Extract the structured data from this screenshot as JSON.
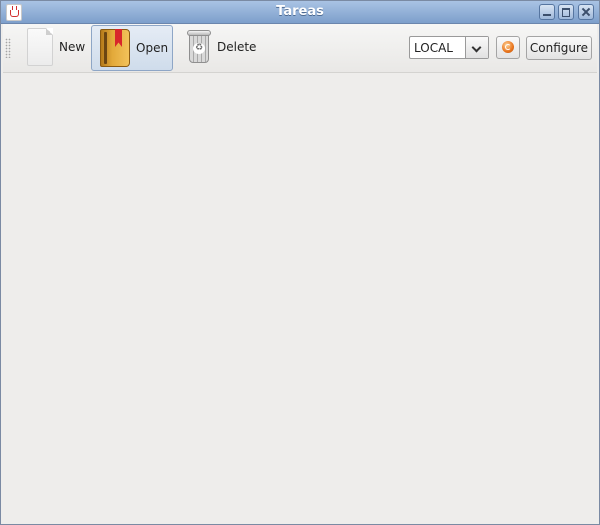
{
  "window": {
    "title": "Tareas",
    "controls": [
      "minimize-icon",
      "maximize-icon",
      "close-icon"
    ]
  },
  "toolbar": {
    "new_label": "New",
    "open_label": "Open",
    "delete_label": "Delete",
    "location_select": {
      "selected": "LOCAL"
    },
    "configure_label": "Configure",
    "icons": {
      "new": "document-icon",
      "open": "book-icon",
      "delete": "trash-icon",
      "refresh": "refresh-icon"
    }
  }
}
